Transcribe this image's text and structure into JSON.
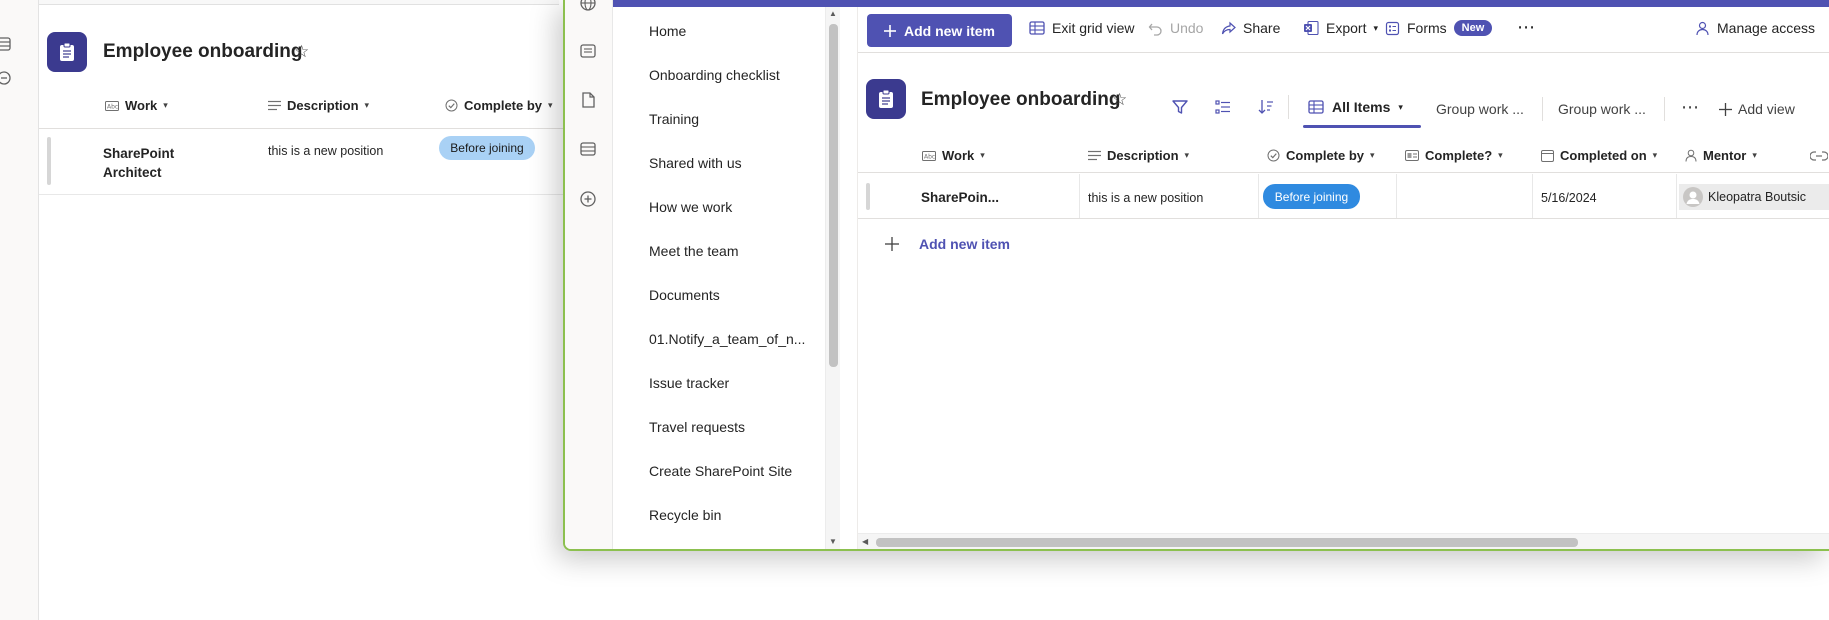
{
  "background": {
    "list_title": "Employee onboarding",
    "columns": [
      {
        "label": "Work",
        "icon": "text-field-icon"
      },
      {
        "label": "Description",
        "icon": "multiline-text-icon"
      },
      {
        "label": "Complete by",
        "icon": "choice-check-icon"
      }
    ],
    "row": {
      "work": "SharePoint Architect",
      "work_line1": "SharePoint",
      "work_line2": "Architect",
      "description": "this is a new position",
      "complete_by": "Before joining"
    }
  },
  "front": {
    "nav": {
      "items": [
        "Home",
        "Onboarding checklist",
        "Training",
        "Shared with us",
        "How we work",
        "Meet the team",
        "Documents",
        "01.Notify_a_team_of_n...",
        "Issue tracker",
        "Travel requests",
        "Create SharePoint Site",
        "Recycle bin"
      ]
    },
    "command_bar": {
      "add_new_item": "Add new item",
      "exit_grid_view": "Exit grid view",
      "undo": "Undo",
      "share": "Share",
      "export": "Export",
      "forms": "Forms",
      "forms_badge": "New",
      "more": "⋯",
      "manage_access": "Manage access"
    },
    "list": {
      "title": "Employee onboarding",
      "views": {
        "active": "All Items",
        "group1": "Group work ...",
        "group2": "Group work ...",
        "more": "⋯",
        "add_view": "Add view"
      }
    },
    "grid": {
      "columns": [
        {
          "label": "Work",
          "icon": "text-field-icon"
        },
        {
          "label": "Description",
          "icon": "multiline-text-icon"
        },
        {
          "label": "Complete by",
          "icon": "choice-check-icon"
        },
        {
          "label": "Complete?",
          "icon": "yes-no-icon"
        },
        {
          "label": "Completed on",
          "icon": "calendar-icon"
        },
        {
          "label": "Mentor",
          "icon": "person-icon"
        }
      ],
      "row": {
        "work": "SharePoin...",
        "description": "this is a new position",
        "complete_by": "Before joining",
        "complete": "",
        "completed_on": "5/16/2024",
        "mentor": "Kleopatra Boutsic"
      },
      "add_new_item": "Add new item"
    }
  },
  "colors": {
    "accent": "#4f52b2",
    "logo": "#3b3a8f",
    "pill_front": "#2f8ae0",
    "pill_back": "#a9d1f5",
    "window_border": "#8cc04f"
  }
}
